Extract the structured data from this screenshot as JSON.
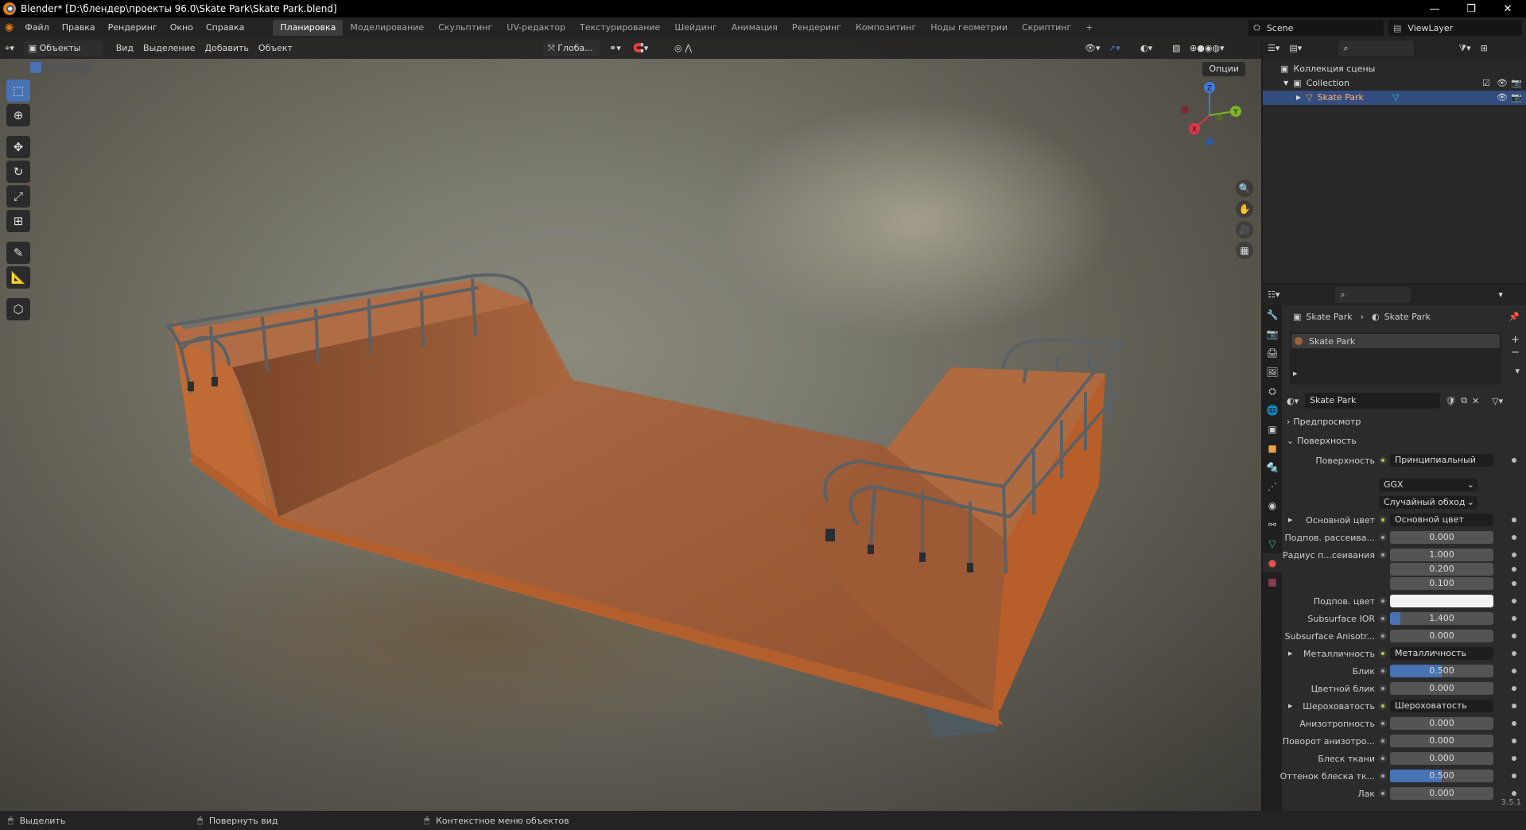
{
  "titlebar": {
    "title": "Blender* [D:\\блендер\\проекты 96.0\\Skate Park\\Skate Park.blend]",
    "min": "—",
    "max": "❐",
    "close": "✕"
  },
  "menubar": {
    "items": [
      "Файл",
      "Правка",
      "Рендеринг",
      "Окно",
      "Справка"
    ],
    "workspaces": [
      "Планировка",
      "Моделирование",
      "Скульптинг",
      "UV-редактор",
      "Текстурирование",
      "Шейдинг",
      "Анимация",
      "Рендеринг",
      "Композитинг",
      "Ноды геометрии",
      "Скриптинг"
    ],
    "add_tab": "+",
    "scene": "Scene",
    "viewlayer": "ViewLayer"
  },
  "viewport": {
    "mode": "Объекты",
    "menus": [
      "Вид",
      "Выделение",
      "Добавить",
      "Объект"
    ],
    "transform": "Глоба...",
    "options": "Опции",
    "gizmo": {
      "x": "X",
      "y": "Y",
      "z": "Z"
    }
  },
  "outliner": {
    "scene_collection": "Коллекция сцены",
    "collection": "Collection",
    "object": "Skate Park"
  },
  "properties": {
    "breadcrumb": [
      "Skate Park",
      "Skate Park"
    ],
    "slot": "Skate Park",
    "material": "Skate Park",
    "preview": "Предпросмотр",
    "surface": "Поверхность",
    "rows": [
      {
        "label": "Поверхность",
        "value": "Принципиальный BSDF",
        "kind": "dark"
      },
      {
        "label": "",
        "value": "GGX",
        "kind": "dark"
      },
      {
        "label": "",
        "value": "Случайный обход",
        "kind": "dark"
      },
      {
        "label": "Основной цвет",
        "value": "Основной цвет",
        "kind": "dark"
      },
      {
        "label": "Подпов. рассеива...",
        "value": "0.000",
        "kind": "num"
      },
      {
        "label": "Радиус п...сеивания",
        "value": "1.000",
        "kind": "num"
      },
      {
        "label": "",
        "value": "0.200",
        "kind": "num"
      },
      {
        "label": "",
        "value": "0.100",
        "kind": "num"
      },
      {
        "label": "Подпов. цвет",
        "value": "",
        "kind": "color"
      },
      {
        "label": "Subsurface IOR",
        "value": "1.400",
        "kind": "num"
      },
      {
        "label": "Subsurface Anisotr...",
        "value": "0.000",
        "kind": "num"
      },
      {
        "label": "Металличность",
        "value": "Металличность",
        "kind": "dark"
      },
      {
        "label": "Блик",
        "value": "0.500",
        "kind": "num"
      },
      {
        "label": "Цветной блик",
        "value": "0.000",
        "kind": "num"
      },
      {
        "label": "Шероховатость",
        "value": "Шероховатость",
        "kind": "dark"
      },
      {
        "label": "Анизотропность",
        "value": "0.000",
        "kind": "num"
      },
      {
        "label": "Поворот анизотро...",
        "value": "0.000",
        "kind": "num"
      },
      {
        "label": "Блеск ткани",
        "value": "0.000",
        "kind": "num"
      },
      {
        "label": "Оттенок блеска тк...",
        "value": "0.500",
        "kind": "num"
      },
      {
        "label": "Лак",
        "value": "0.000",
        "kind": "num"
      }
    ]
  },
  "status": {
    "select": "Выделить",
    "rotate": "Повернуть вид",
    "context": "Контекстное меню объектов",
    "version": "3.5.1"
  }
}
